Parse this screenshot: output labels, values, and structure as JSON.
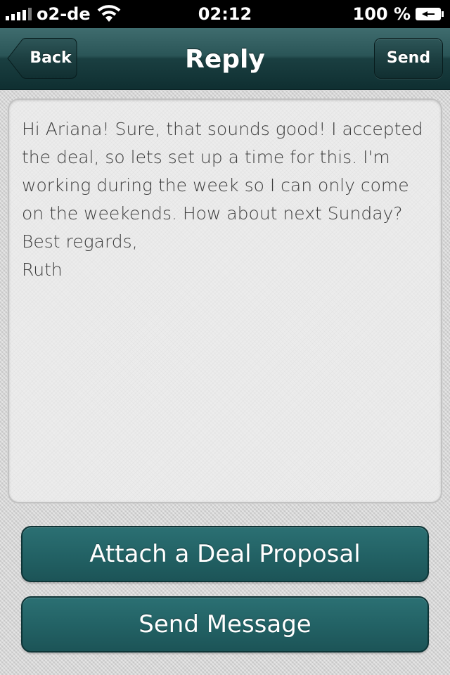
{
  "status_bar": {
    "carrier": "o2-de",
    "time": "02:12",
    "battery_percent": "100 %",
    "signal_icon": "signal-bars-icon",
    "wifi_icon": "wifi-icon",
    "battery_icon": "battery-charging-icon"
  },
  "nav": {
    "title": "Reply",
    "back_label": "Back",
    "send_label": "Send"
  },
  "message": {
    "body": "Hi Ariana! Sure, that sounds good! I accepted\nthe deal, so lets set up a time for this. I'm\nworking during the week so I can only come\non the weekends. How about next Sunday?\nBest regards,\nRuth"
  },
  "actions": {
    "attach_label": "Attach a Deal Proposal",
    "send_message_label": "Send Message"
  },
  "colors": {
    "nav_bar": "#1f4a4c",
    "button_teal": "#226164",
    "background": "#d6d6d6"
  }
}
